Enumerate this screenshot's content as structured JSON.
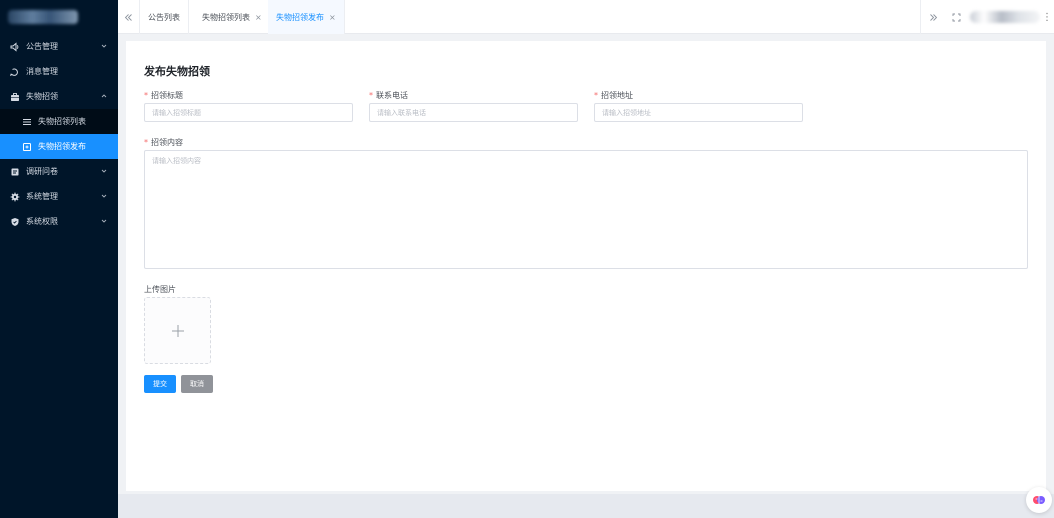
{
  "sidebar": {
    "items": [
      {
        "label": "公告管理",
        "icon": "speaker-icon"
      },
      {
        "label": "消息管理",
        "icon": "message-icon"
      },
      {
        "label": "失物招领",
        "icon": "briefcase-icon"
      },
      {
        "label": "调研问卷",
        "icon": "survey-icon"
      },
      {
        "label": "系统管理",
        "icon": "gear-icon"
      },
      {
        "label": "系统权限",
        "icon": "shield-icon"
      }
    ],
    "subitems": [
      {
        "label": "失物招领列表",
        "icon": "list-icon"
      },
      {
        "label": "失物招领发布",
        "icon": "edit-icon"
      }
    ]
  },
  "tabs": [
    {
      "label": "公告列表",
      "closable": false
    },
    {
      "label": "失物招领列表",
      "closable": true,
      "close": "×"
    },
    {
      "label": "失物招领发布",
      "closable": true,
      "close": "×",
      "active": true
    }
  ],
  "topbar": {
    "more": "⋮"
  },
  "form": {
    "title": "发布失物招领",
    "required_mark": "*",
    "fields": {
      "title": {
        "label": "招领标题",
        "placeholder": "请输入招领标题",
        "value": ""
      },
      "phone": {
        "label": "联系电话",
        "placeholder": "请输入联系电话",
        "value": ""
      },
      "address": {
        "label": "招领地址",
        "placeholder": "请输入招领地址",
        "value": ""
      },
      "content": {
        "label": "招领内容",
        "placeholder": "请输入招领内容",
        "value": ""
      }
    },
    "upload_label": "上传图片",
    "submit_label": "提交",
    "cancel_label": "取消"
  },
  "colors": {
    "sidebar": "#001529",
    "accent": "#1890ff",
    "danger": "#f56c6c",
    "cancel": "#909399"
  }
}
